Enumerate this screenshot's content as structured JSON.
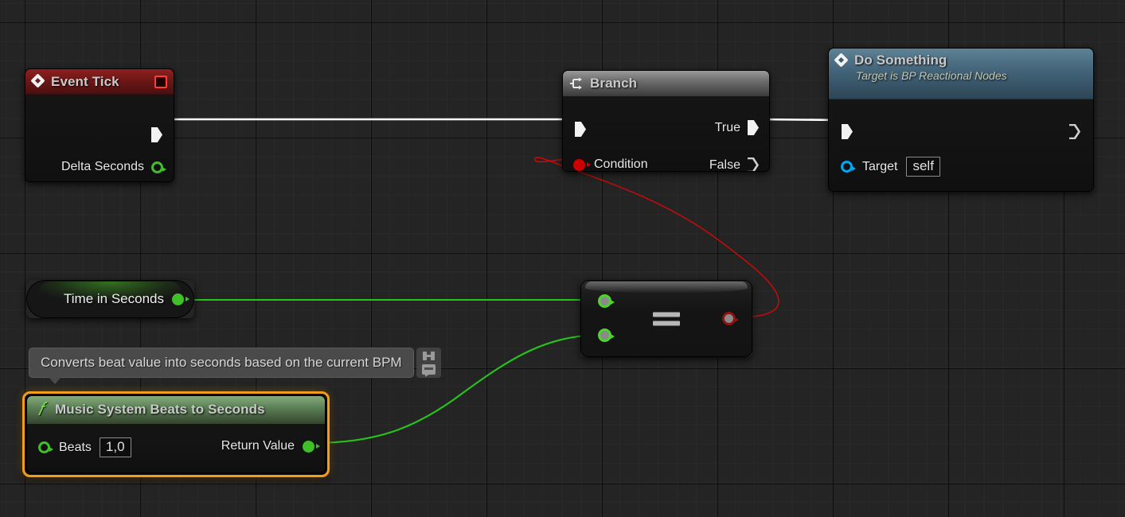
{
  "app": {
    "context": "Unreal Engine Blueprint Event Graph",
    "background_color": "#242424",
    "grid_minor_color": "#2b2b2b",
    "grid_major_color": "#000000"
  },
  "nodes": {
    "event_tick": {
      "title": "Event Tick",
      "icon": "event-diamond-icon",
      "header_color": "#7a1b1b",
      "badge": "stop-square-badge",
      "output_exec_label": "",
      "pins": [
        {
          "name": "Delta Seconds",
          "type": "float",
          "color": "#3fbf28",
          "style": "ring",
          "side": "output"
        }
      ]
    },
    "branch": {
      "title": "Branch",
      "icon": "branch-fork-icon",
      "header_color": "#6e6e6e",
      "inputs": [
        {
          "name": "",
          "type": "exec",
          "color": "#ffffff"
        },
        {
          "name": "Condition",
          "type": "bool",
          "color": "#cc0000",
          "style": "filled"
        }
      ],
      "outputs": [
        {
          "name": "True",
          "type": "exec",
          "color": "#ffffff",
          "connected": true
        },
        {
          "name": "False",
          "type": "exec",
          "color": "#cfcfcf",
          "connected": false
        }
      ]
    },
    "do_something": {
      "title": "Do Something",
      "subtitle": "Target is BP Reactional Nodes",
      "icon": "event-diamond-icon",
      "header_color": "#44657a",
      "inputs": [
        {
          "name": "",
          "type": "exec",
          "color": "#ffffff"
        },
        {
          "name": "Target",
          "type": "object",
          "color": "#00a8f3",
          "style": "ring",
          "value": "self"
        }
      ],
      "outputs": [
        {
          "name": "",
          "type": "exec",
          "color": "#cfcfcf",
          "connected": false
        }
      ]
    },
    "time_in_seconds": {
      "title": "Time in Seconds",
      "kind": "variable-get",
      "pins": [
        {
          "name": "",
          "type": "float",
          "color": "#3fbf28",
          "style": "filled",
          "side": "output"
        }
      ]
    },
    "equality": {
      "operator": "==",
      "kind": "compact-pure-node",
      "inputs": [
        {
          "name": "",
          "type": "float",
          "color": "#4cd62a",
          "style": "ring"
        },
        {
          "name": "",
          "type": "float",
          "color": "#4cd62a",
          "style": "ring"
        }
      ],
      "outputs": [
        {
          "name": "",
          "type": "bool",
          "color": "#8f1212",
          "style": "ring"
        }
      ]
    },
    "beats_to_seconds": {
      "title": "Music System Beats to Seconds",
      "icon": "function-fx-icon",
      "header_color": "#5f8459",
      "selected": true,
      "selection_color": "#f29d1c",
      "inputs": [
        {
          "name": "Beats",
          "type": "float",
          "color": "#3fbf28",
          "style": "ring",
          "value": "1,0"
        }
      ],
      "outputs": [
        {
          "name": "Return Value",
          "type": "float",
          "color": "#3fbf28",
          "style": "filled"
        }
      ]
    }
  },
  "tooltip": {
    "text": "Converts beat value into seconds based on the current BPM",
    "actions": [
      {
        "icon": "pin-icon",
        "name": "pin-tooltip"
      },
      {
        "icon": "comment-bubble-icon",
        "name": "add-comment"
      }
    ]
  },
  "wires": [
    {
      "name": "exec-tick-to-branch",
      "from": "event_tick.exec_out",
      "to": "branch.exec_in",
      "color": "#ffffff",
      "type": "exec"
    },
    {
      "name": "exec-branch-true-to-do-something",
      "from": "branch.true",
      "to": "do_something.exec_in",
      "color": "#ffffff",
      "type": "exec"
    },
    {
      "name": "data-time-to-equality-a",
      "from": "time_in_seconds.out",
      "to": "equality.in_a",
      "color": "#27c41a",
      "type": "float"
    },
    {
      "name": "data-return-to-equality-b",
      "from": "beats_to_seconds.return_value",
      "to": "equality.in_b",
      "color": "#27c41a",
      "type": "float"
    },
    {
      "name": "data-equality-to-condition",
      "from": "equality.out",
      "to": "branch.condition",
      "color": "#c00c0c",
      "type": "bool"
    }
  ]
}
